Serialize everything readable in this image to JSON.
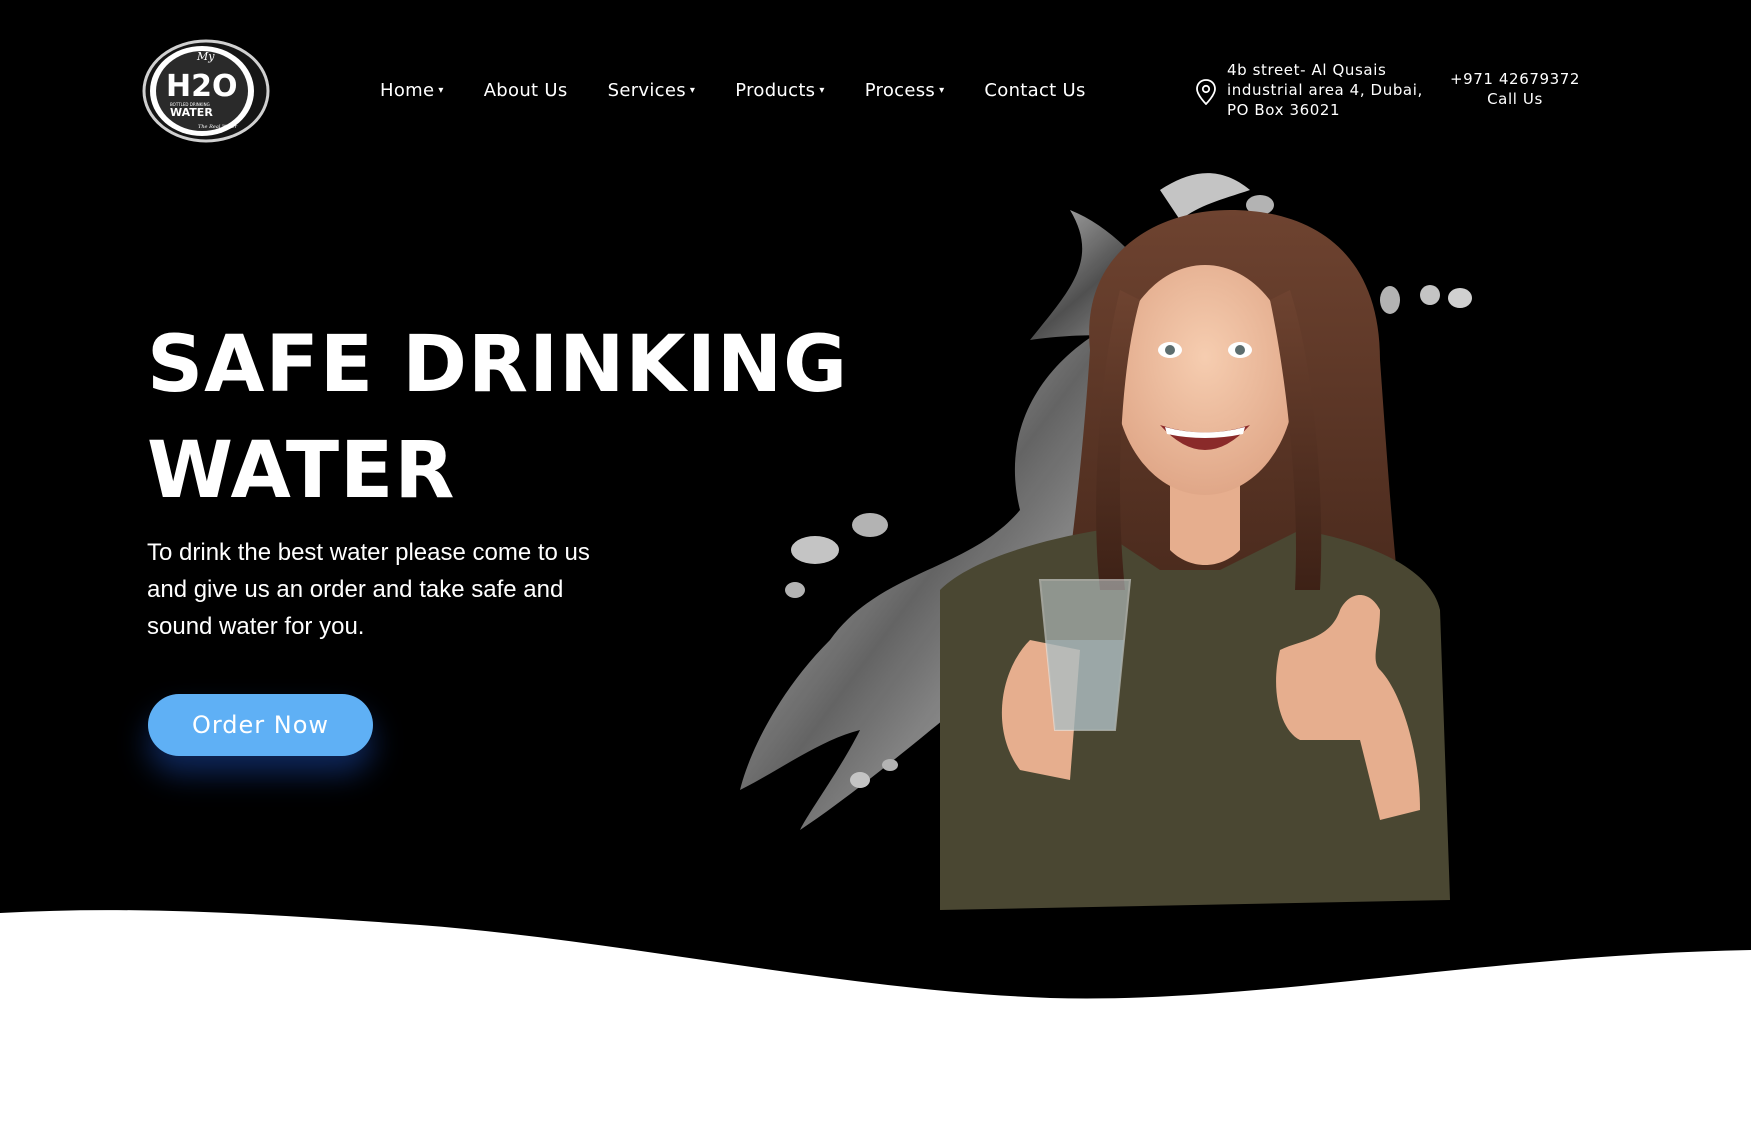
{
  "brand": {
    "logo_alt": "My H2O Bottled Drinking Water - The Real Water",
    "logo_small_top": "My",
    "logo_main": "H2O",
    "logo_sub": "BOTTLED DRINKING",
    "logo_word": "WATER",
    "logo_tagline": "The Real Water"
  },
  "nav": {
    "items": [
      {
        "label": "Home",
        "dropdown": true
      },
      {
        "label": "About Us",
        "dropdown": false
      },
      {
        "label": "Services",
        "dropdown": true
      },
      {
        "label": "Products",
        "dropdown": true
      },
      {
        "label": "Process",
        "dropdown": true
      },
      {
        "label": "Contact Us",
        "dropdown": false
      }
    ],
    "caret": "▾"
  },
  "contact": {
    "address_lines": [
      "4b street- Al Qusais",
      "industrial area 4, Dubai,",
      "PO Box 36021"
    ],
    "address_icon": "map-pin-icon",
    "phone": "+971 42679372",
    "phone_label": "Call Us"
  },
  "hero": {
    "title_lines": [
      "SAFE DRINKING",
      "WATER"
    ],
    "description_lines": [
      "To drink the best water please come to us",
      "and give us an order and take safe and",
      "sound water for you."
    ],
    "cta_label": "Order Now"
  },
  "colors": {
    "background": "#000000",
    "accent": "#5fb0f5",
    "text": "#ffffff",
    "wave": "#ffffff"
  }
}
